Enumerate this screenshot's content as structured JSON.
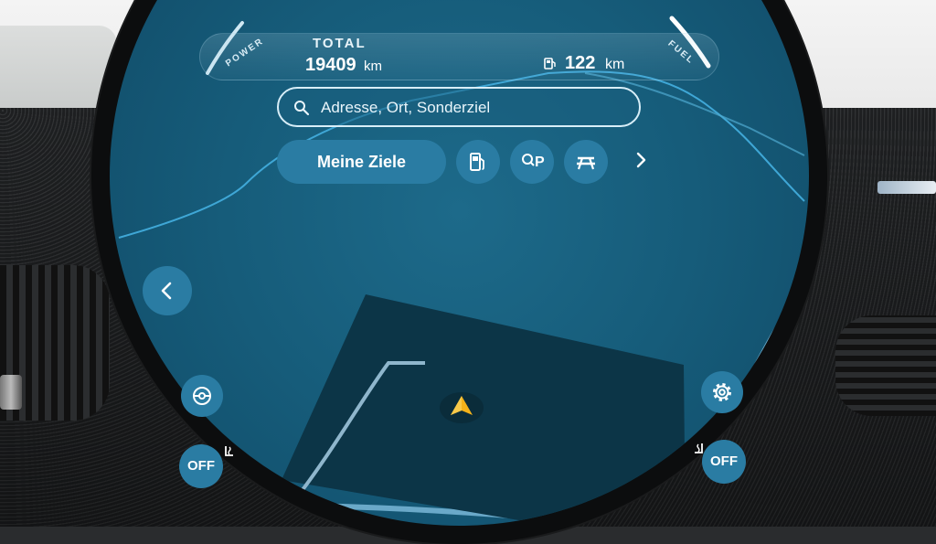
{
  "cluster": {
    "power_label": "POWER",
    "fuel_label": "FUEL",
    "total_label": "TOTAL",
    "odometer_value": "19409",
    "odometer_unit": "km",
    "range_value": "122",
    "range_unit": "km",
    "range_icon": "fuel-pump-icon"
  },
  "search": {
    "placeholder": "Adresse, Ort, Sonderziel",
    "icon": "search-icon"
  },
  "shortcuts": {
    "my_destinations_label": "Meine Ziele",
    "items": [
      {
        "icon": "fuel-station-icon"
      },
      {
        "icon": "parking-search-icon"
      },
      {
        "icon": "picnic-table-icon"
      }
    ],
    "more_icon": "chevron-right-icon"
  },
  "controls": {
    "back_icon": "chevron-left-icon",
    "steering_icon": "steering-wheel-icon",
    "settings_icon": "gear-icon",
    "left_seat_label": "OFF",
    "right_seat_label": "OFF",
    "seat_heat_icon": "seat-heating-icon"
  },
  "map": {
    "position_icon": "navigation-arrow-icon"
  },
  "colors": {
    "accent": "#2a7ca3",
    "heat": "#e0504a",
    "cool": "#5fd0f0",
    "nav_arrow": "#f3b21a"
  }
}
